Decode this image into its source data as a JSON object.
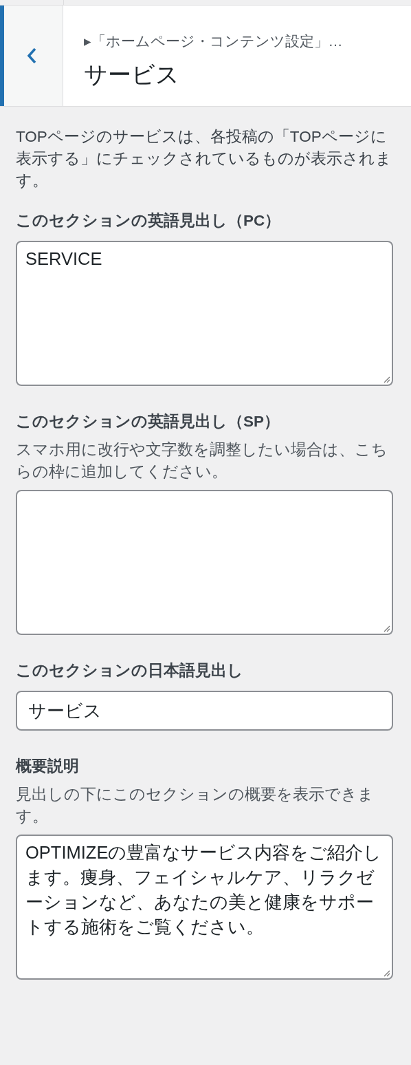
{
  "header": {
    "breadcrumb": "▸「ホームページ・コンテンツ設定」…",
    "title": "サービス"
  },
  "intro": "TOPページのサービスは、各投稿の「TOPページに表示する」にチェックされているものが表示されます。",
  "controls": [
    {
      "kind": "textarea",
      "label": "このセクションの英語見出し（PC）",
      "value": "SERVICE"
    },
    {
      "kind": "textarea",
      "label": "このセクションの英語見出し（SP）",
      "description": "スマホ用に改行や文字数を調整したい場合は、こちらの枠に追加してください。"
    },
    {
      "kind": "input",
      "label": "このセクションの日本語見出し",
      "value": "サービス"
    },
    {
      "kind": "textarea",
      "label": "概要説明",
      "description": "見出しの下にこのセクションの概要を表示できます。",
      "value": "OPTIMIZEの豊富なサービス内容をご紹介します。痩身、フェイシャルケア、リラクゼーションなど、あなたの美と健康をサポートする施術をご覧ください。"
    }
  ]
}
